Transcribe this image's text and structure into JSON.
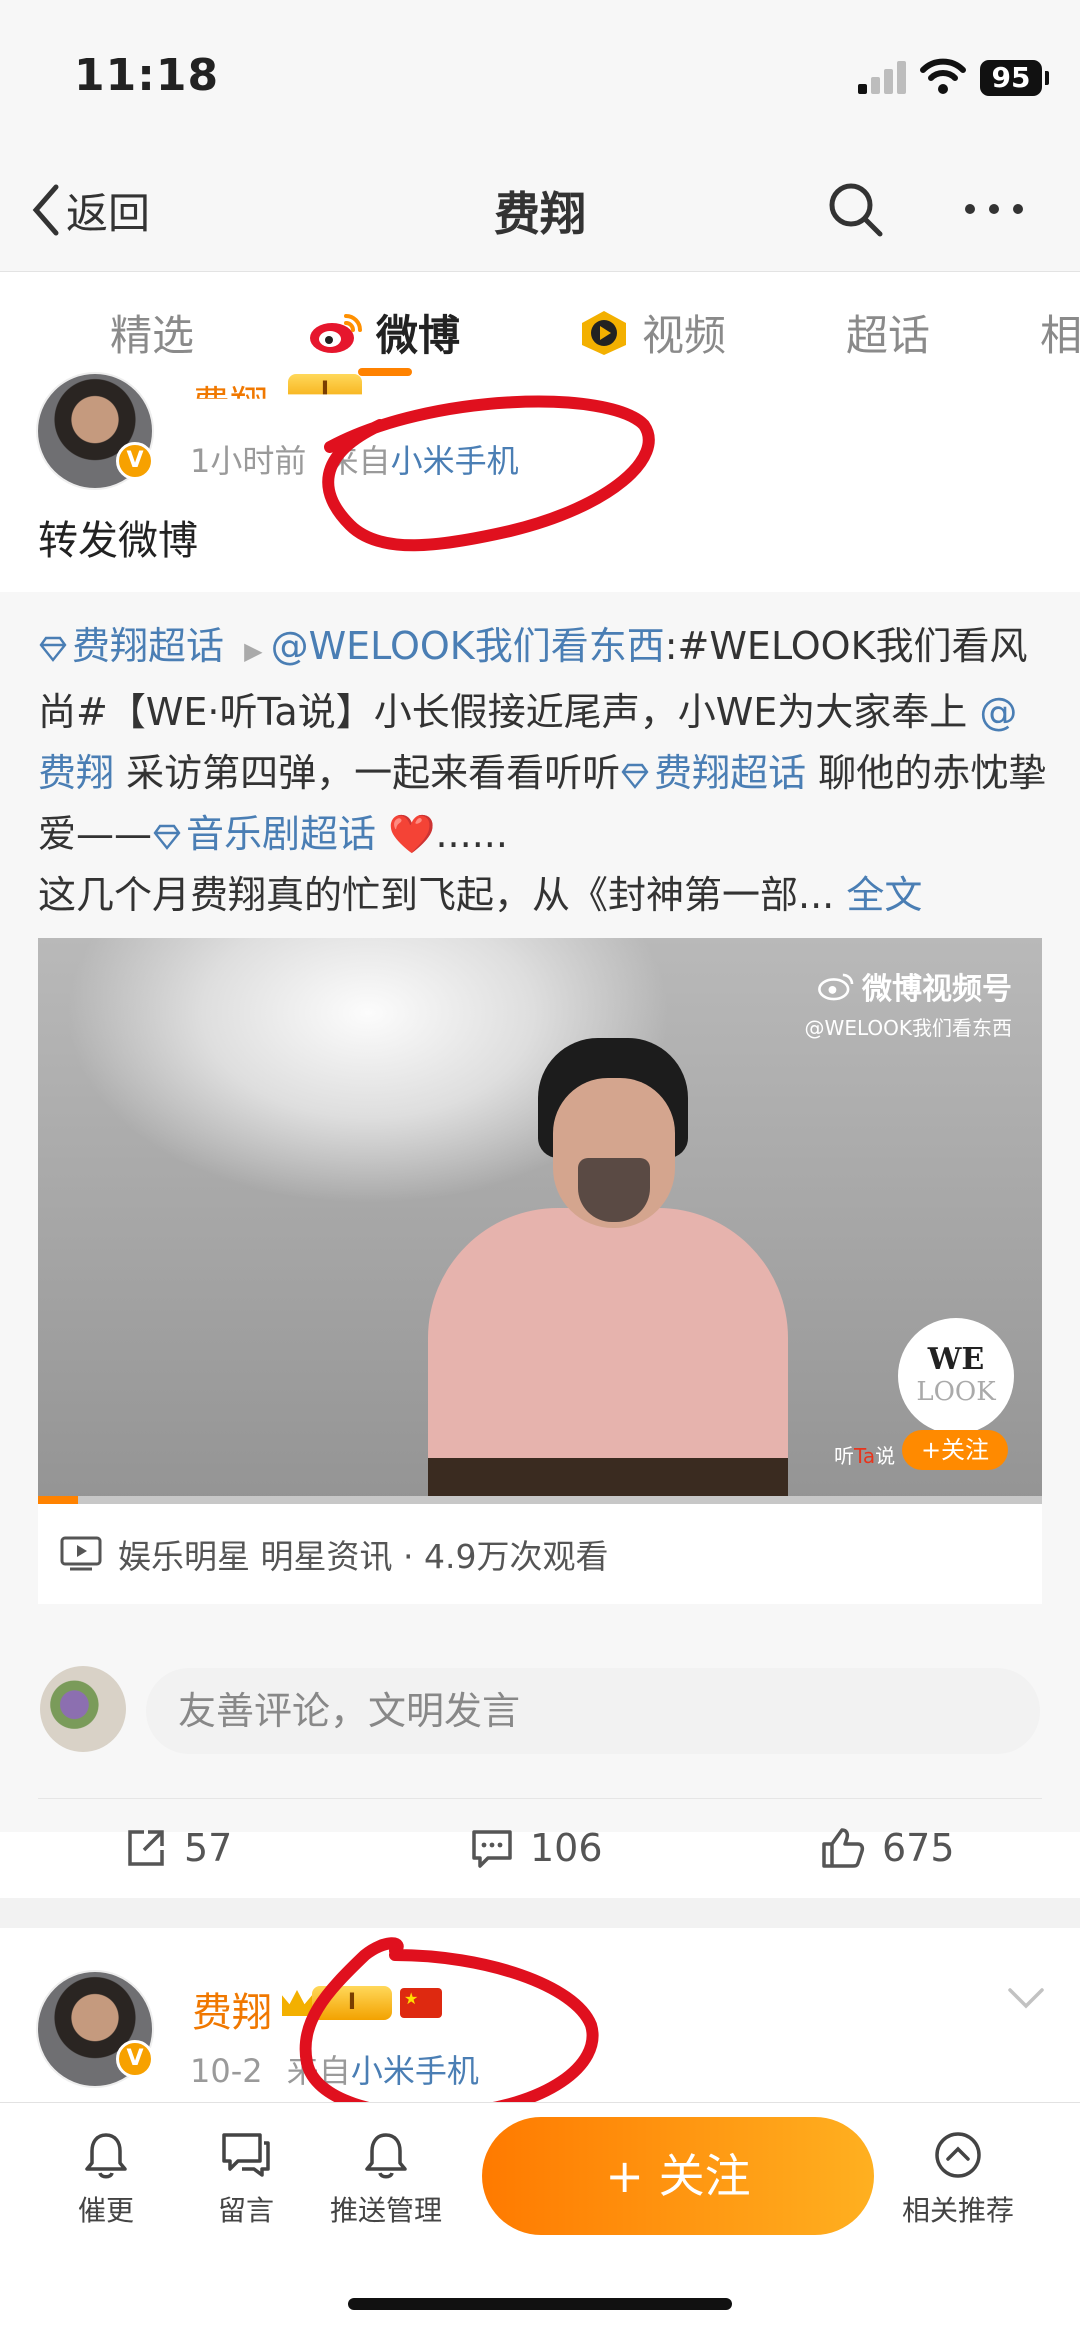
{
  "status": {
    "time": "11:18",
    "battery": "95"
  },
  "navbar": {
    "back_label": "返回",
    "title": "费翔",
    "search_icon": "search-icon",
    "more_icon": "more-icon"
  },
  "tabs": [
    {
      "label": "精选"
    },
    {
      "label": "微博"
    },
    {
      "label": "视频"
    },
    {
      "label": "超话"
    },
    {
      "label": "相"
    }
  ],
  "active_tab": "微博",
  "post1": {
    "author": "费翔",
    "level": "I",
    "time": "1小时前",
    "source_prefix": "来自",
    "source": "小米手机",
    "text": "转发微博",
    "repost": {
      "supertopic_1": "费翔超话",
      "mention_1": "@WELOOK我们看东西",
      "text_1": ":#WELOOK我们看风尚#【WE·听Ta说】小长假接近尾声，小WE为大家奉上",
      "mention_2": "@费翔",
      "text_2": "采访第四弹，一起来看看听听",
      "supertopic_2": "费翔超话",
      "text_3": "聊他的赤忱挚爱——",
      "supertopic_3": "音乐剧超话",
      "emoji": "❤️",
      "ellipsis": "......",
      "text_4": "这几个月费翔真的忙到飞起，从《封神第一部...",
      "full_text": "全文"
    },
    "video": {
      "watermark": "微博视频号",
      "watermark_handle": "@WELOOK我们看东西",
      "logo_top": "WE",
      "logo_bottom": "LOOK",
      "caption_prefix": "听",
      "caption_ta": "Ta",
      "caption_suffix": "说",
      "follow_label": "+关注",
      "progress": 0.04,
      "info": "娱乐明星 明星资讯 · 4.9万次观看"
    },
    "comment_placeholder": "友善评论，文明发言",
    "reposts": "57",
    "comments": "106",
    "likes": "675"
  },
  "post2": {
    "author": "费翔",
    "level": "I",
    "time": "10-2",
    "source_prefix": "来自",
    "source": "小米手机"
  },
  "bottombar": {
    "remind": "催更",
    "message": "留言",
    "push": "推送管理",
    "follow": "+ 关注",
    "related": "相关推荐"
  },
  "colors": {
    "accent": "#ff8200",
    "link": "#4a7eb4",
    "username": "#f07800",
    "annotation": "#e0101e"
  }
}
